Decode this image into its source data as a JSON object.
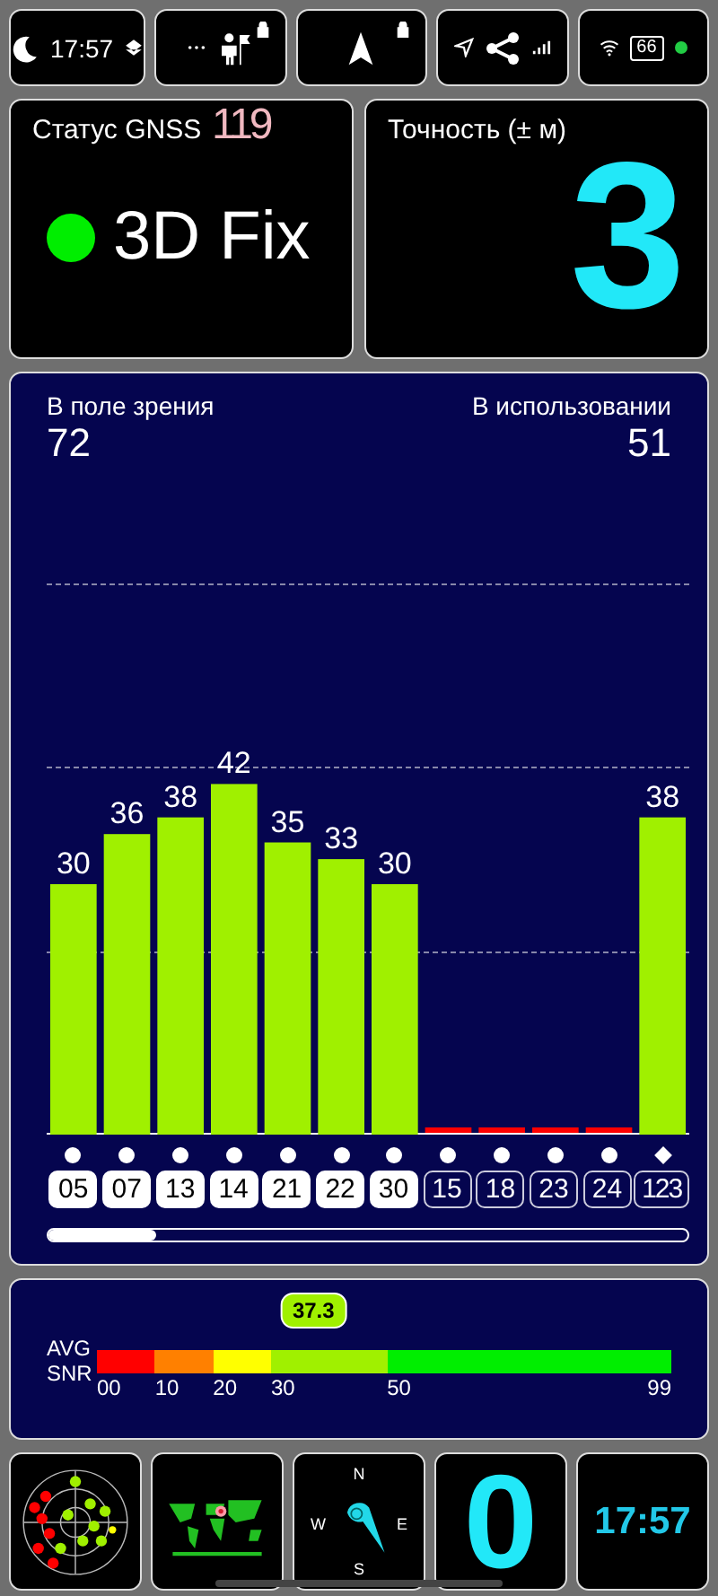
{
  "status_bar": {
    "time": "17:57",
    "battery": "66"
  },
  "gnss_status": {
    "label": "Статус GNSS",
    "overlay": "119",
    "fix": "3D Fix",
    "color": "#00ee00"
  },
  "accuracy": {
    "label": "Точность (± м)",
    "value": "3"
  },
  "satellites": {
    "in_view_label": "В поле зрения",
    "in_view": "72",
    "in_use_label": "В использовании",
    "in_use": "51",
    "chart_data": {
      "type": "bar",
      "categories": [
        "05",
        "07",
        "13",
        "14",
        "21",
        "22",
        "30",
        "15",
        "18",
        "23",
        "24",
        "123"
      ],
      "values": [
        30,
        36,
        38,
        42,
        35,
        33,
        30,
        0,
        0,
        0,
        0,
        38
      ],
      "value_labels": [
        "30",
        "36",
        "38",
        "42",
        "35",
        "33",
        "30",
        null,
        null,
        null,
        null,
        "38"
      ]
    },
    "items": [
      {
        "used": true,
        "kind": "dot"
      },
      {
        "used": true,
        "kind": "dot"
      },
      {
        "used": true,
        "kind": "dot"
      },
      {
        "used": true,
        "kind": "dot"
      },
      {
        "used": true,
        "kind": "dot"
      },
      {
        "used": true,
        "kind": "dot"
      },
      {
        "used": true,
        "kind": "dot"
      },
      {
        "used": false,
        "kind": "dot"
      },
      {
        "used": false,
        "kind": "dot"
      },
      {
        "used": false,
        "kind": "dot"
      },
      {
        "used": false,
        "kind": "dot"
      },
      {
        "used": false,
        "kind": "diamond"
      }
    ]
  },
  "snr": {
    "label_top": "AVG",
    "label_bottom": "SNR",
    "average": "37.3",
    "level": 0.377,
    "scale": [
      {
        "label": "00",
        "color": "#ff0000"
      },
      {
        "label": "10",
        "color": "#ff8000"
      },
      {
        "label": "20",
        "color": "#ffff00"
      },
      {
        "label": "30",
        "color": "#a0f000"
      },
      {
        "label": "50",
        "color": "#00ee00"
      },
      {
        "label": "99"
      }
    ]
  },
  "bottom": {
    "compass": {
      "n": "N",
      "e": "E",
      "s": "S",
      "w": "W"
    },
    "counter": "0",
    "clock": "17:57"
  }
}
